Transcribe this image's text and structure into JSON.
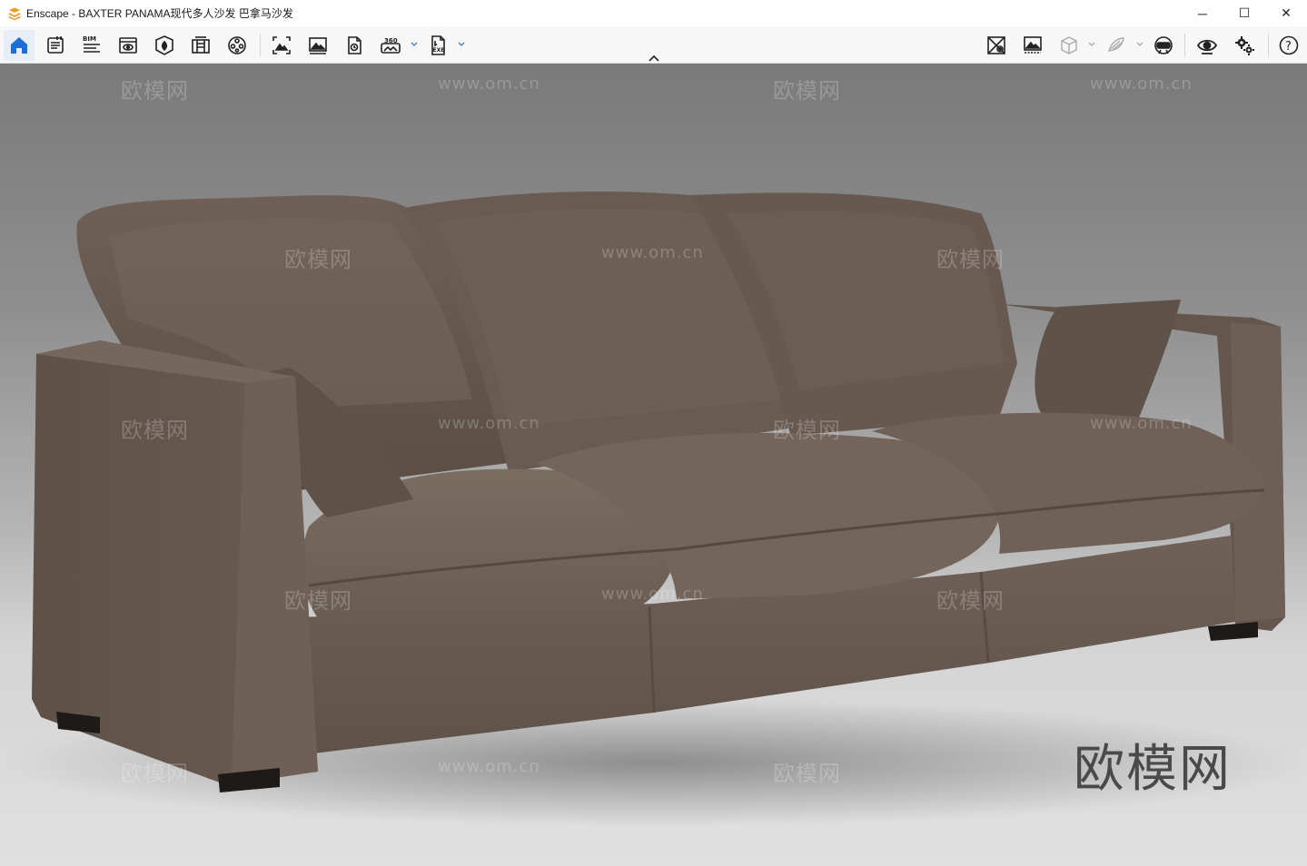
{
  "window": {
    "title": "Enscape - BAXTER PANAMA现代多人沙发 巴拿马沙发",
    "controls": {
      "minimize": "─",
      "maximize": "☐",
      "close": "✕"
    }
  },
  "toolbar": {
    "left_tools": [
      {
        "icon": "home-icon",
        "active": true
      },
      {
        "icon": "notes-icon"
      },
      {
        "icon": "bim-icon",
        "label": "BIM"
      },
      {
        "icon": "view-icon"
      },
      {
        "icon": "asset-library-icon"
      },
      {
        "icon": "material-editor-icon"
      },
      {
        "icon": "video-editor-icon"
      },
      {
        "icon": "screenshot-icon"
      },
      {
        "icon": "render-image-icon"
      },
      {
        "icon": "batch-render-icon"
      },
      {
        "icon": "panorama-360-icon",
        "label": "360"
      },
      {
        "icon": "exe-export-icon",
        "label": "EXE"
      }
    ],
    "right_tools": [
      {
        "icon": "atmosphere-icon"
      },
      {
        "icon": "visual-settings-icon"
      },
      {
        "icon": "cube-view-icon"
      },
      {
        "icon": "sketch-icon"
      },
      {
        "icon": "vr-headset-icon"
      },
      {
        "icon": "eye-icon"
      },
      {
        "icon": "gears-icon"
      },
      {
        "icon": "help-icon",
        "label": "?"
      }
    ]
  },
  "viewport": {
    "watermark_text": "欧模网",
    "watermark_url": "www.om.cn",
    "brand_watermark": "欧模网",
    "colors": {
      "sofa_fabric": "#6b5d52",
      "sofa_shadow": "#4a3f37",
      "sofa_highlight": "#7d6f64",
      "background_top": "#7a7a7a",
      "floor": "#dddddd"
    }
  }
}
